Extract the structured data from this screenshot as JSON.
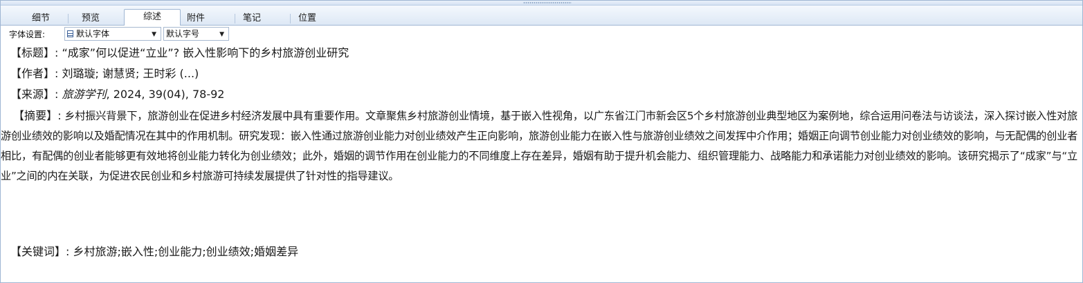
{
  "tabs": [
    {
      "label": "细节",
      "active": false
    },
    {
      "label": "预览",
      "active": false
    },
    {
      "label": "综述",
      "active": true
    },
    {
      "label": "附件",
      "active": false
    },
    {
      "label": "笔记",
      "active": false
    },
    {
      "label": "位置",
      "active": false
    }
  ],
  "toolbar": {
    "font_setting_label": "字体设置:",
    "font_family_value": "默认字体",
    "font_size_value": "默认字号"
  },
  "record": {
    "title_label": "【标题】:",
    "title": "“成家”何以促进“立业”? 嵌入性影响下的乡村旅游创业研究",
    "author_label": "【作者】:",
    "authors": "刘璐璇; 谢慧贤; 王时彩 (...)",
    "source_label": "【来源】:",
    "source_journal": "旅游学刊",
    "source_details": ", 2024, 39(04), 78-92",
    "abstract_label": "【摘要】:",
    "abstract": "乡村振兴背景下，旅游创业在促进乡村经济发展中具有重要作用。文章聚焦乡村旅游创业情境，基于嵌入性视角，以广东省江门市新会区5个乡村旅游创业典型地区为案例地，综合运用问卷法与访谈法，深入探讨嵌入性对旅游创业绩效的影响以及婚配情况在其中的作用机制。研究发现：嵌入性通过旅游创业能力对创业绩效产生正向影响，旅游创业能力在嵌入性与旅游创业绩效之间发挥中介作用；婚姻正向调节创业能力对创业绩效的影响，与无配偶的创业者相比，有配偶的创业者能够更有效地将创业能力转化为创业绩效；此外，婚姻的调节作用在创业能力的不同维度上存在差异，婚姻有助于提升机会能力、组织管理能力、战略能力和承诺能力对创业绩效的影响。该研究揭示了“成家”与“立业”之间的内在关联，为促进农民创业和乡村旅游可持续发展提供了针对性的指导建议。",
    "keywords_label": "【关键词】:",
    "keywords": "乡村旅游;嵌入性;创业能力;创业绩效;婚姻差异"
  }
}
